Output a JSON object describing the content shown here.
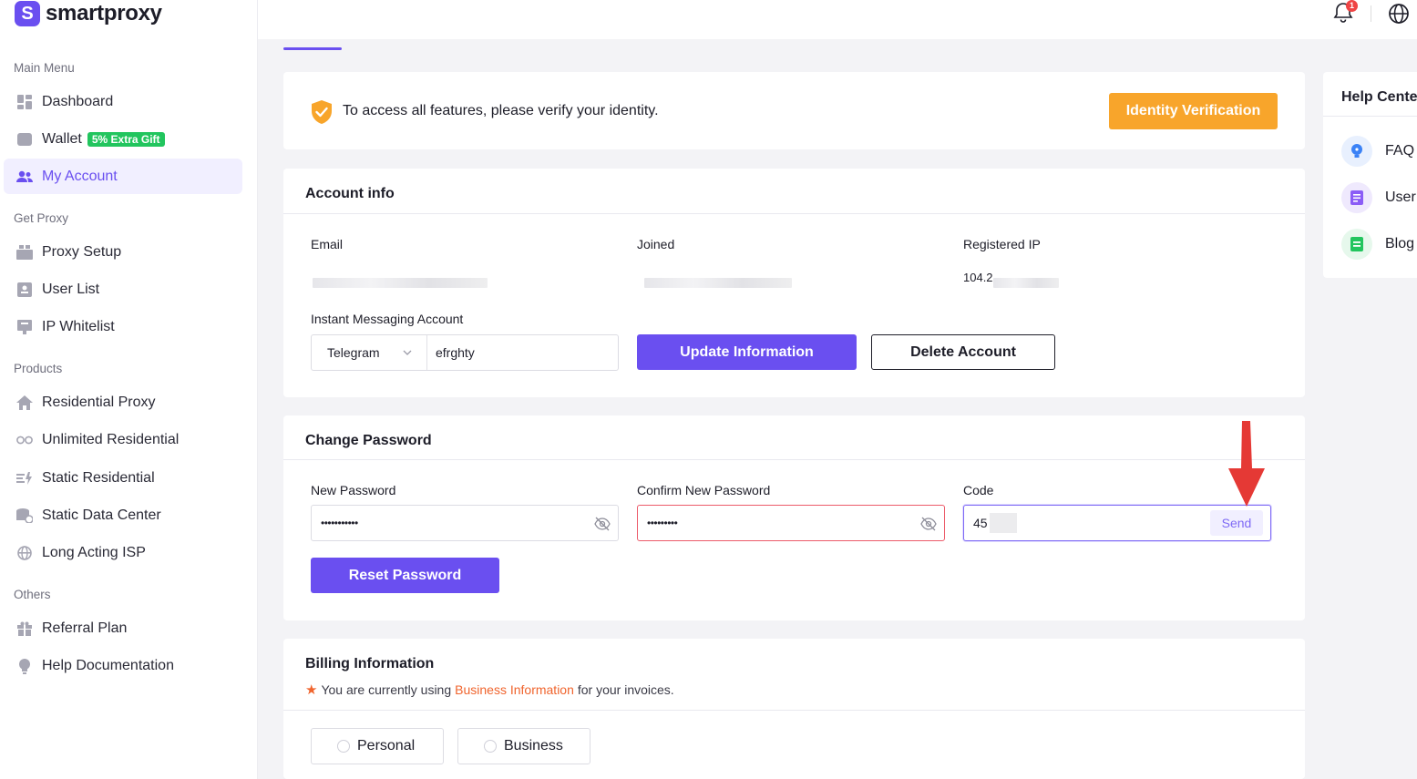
{
  "brand": {
    "name": "smartproxy"
  },
  "sidebar": {
    "sections": {
      "main": "Main Menu",
      "get_proxy": "Get Proxy",
      "products": "Products",
      "others": "Others"
    },
    "items": [
      {
        "label": "Dashboard",
        "icon": "dashboard-icon"
      },
      {
        "label": "Wallet",
        "icon": "wallet-icon",
        "badge": "5% Extra Gift"
      },
      {
        "label": "My Account",
        "icon": "users-icon",
        "active": true
      },
      {
        "label": "Proxy Setup",
        "icon": "proxy-setup-icon"
      },
      {
        "label": "User List",
        "icon": "user-list-icon"
      },
      {
        "label": "IP Whitelist",
        "icon": "ip-whitelist-icon"
      },
      {
        "label": "Residential Proxy",
        "icon": "home-icon"
      },
      {
        "label": "Unlimited Residential",
        "icon": "infinity-icon"
      },
      {
        "label": "Static Residential",
        "icon": "static-residential-icon"
      },
      {
        "label": "Static Data Center",
        "icon": "data-center-icon"
      },
      {
        "label": "Long Acting ISP",
        "icon": "isp-icon"
      },
      {
        "label": "Referral Plan",
        "icon": "gift-icon"
      },
      {
        "label": "Help Documentation",
        "icon": "lightbulb-icon"
      }
    ]
  },
  "topbar": {
    "notification_count": "1"
  },
  "verify": {
    "message": "To access all features, please verify your identity.",
    "button": "Identity Verification"
  },
  "account_info": {
    "title": "Account info",
    "email_label": "Email",
    "joined_label": "Joined",
    "registered_ip_label": "Registered IP",
    "registered_ip_value": "104.2",
    "im_label": "Instant Messaging Account",
    "im_type": "Telegram",
    "im_value": "efrghty",
    "update_button": "Update Information",
    "delete_button": "Delete Account"
  },
  "change_password": {
    "title": "Change Password",
    "new_password_label": "New Password",
    "new_password_value": "•••••••••••",
    "confirm_label": "Confirm New Password",
    "confirm_value": "•••••••••",
    "code_label": "Code",
    "code_value": "45",
    "send_button": "Send",
    "reset_button": "Reset Password"
  },
  "billing": {
    "title": "Billing Information",
    "note_prefix": "You are currently using",
    "note_link": "Business Information",
    "note_suffix": "for your invoices.",
    "options": [
      "Personal",
      "Business"
    ]
  },
  "help_center": {
    "title": "Help Cente",
    "items": [
      {
        "label": "FAQ",
        "color": "#3b82f6",
        "bg": "#e8f0fe"
      },
      {
        "label": "User",
        "color": "#8b5cf6",
        "bg": "#efe9fd"
      },
      {
        "label": "Blog",
        "color": "#22c55e",
        "bg": "#e6f8ec"
      }
    ]
  },
  "colors": {
    "accent": "#6a4ff0",
    "orange": "#f8a52b",
    "error": "#ec5b6a",
    "link": "#f0642d"
  }
}
